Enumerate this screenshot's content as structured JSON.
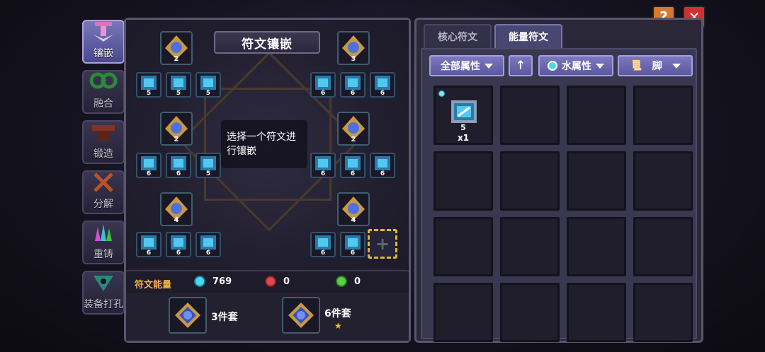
{
  "sidebar": {
    "items": [
      {
        "label": "镶嵌",
        "icon": "inlay-icon",
        "active": true
      },
      {
        "label": "融合",
        "icon": "fusion-icon",
        "active": false
      },
      {
        "label": "锻造",
        "icon": "forge-icon",
        "active": false
      },
      {
        "label": "分解",
        "icon": "decompose-icon",
        "active": false
      },
      {
        "label": "重铸",
        "icon": "recast-icon",
        "active": false
      },
      {
        "label": "装备打孔",
        "icon": "socket-punch-icon",
        "active": false
      }
    ]
  },
  "left_panel": {
    "title": "符文镶嵌",
    "hint": "选择一个符文进行镶嵌",
    "core_runes": [
      {
        "level": "2"
      },
      {
        "level": "3"
      },
      {
        "level": "2"
      },
      {
        "level": "2"
      },
      {
        "level": "4"
      },
      {
        "level": "4"
      }
    ],
    "rune_rows": [
      {
        "left": [
          "5",
          "5",
          "5"
        ],
        "right": [
          "6",
          "6",
          "6"
        ]
      },
      {
        "left": [
          "6",
          "6",
          "5"
        ],
        "right": [
          "6",
          "6",
          "6"
        ]
      },
      {
        "left": [
          "6",
          "6",
          "6"
        ],
        "right": [
          "6",
          "6"
        ]
      }
    ],
    "energy": {
      "label": "符文能量",
      "water": "769",
      "fire": "0",
      "wood": "0"
    },
    "sets": [
      {
        "label": "3件套"
      },
      {
        "label": "6件套",
        "star": "★"
      }
    ]
  },
  "right_panel": {
    "tabs": [
      {
        "label": "核心符文",
        "active": false
      },
      {
        "label": "能量符文",
        "active": true
      }
    ],
    "filters": {
      "attribute": "全部属性",
      "sort_icon": "arrow-up-icon",
      "element": "水属性",
      "slot": "脚"
    },
    "items": [
      {
        "level": "5",
        "count": "x1"
      }
    ]
  },
  "colors": {
    "accent": "#7c78c0",
    "energy_label": "#f0b048",
    "water": "#4ad8f0",
    "fire": "#e04848",
    "wood": "#58d048",
    "selection": "#e0b830"
  }
}
